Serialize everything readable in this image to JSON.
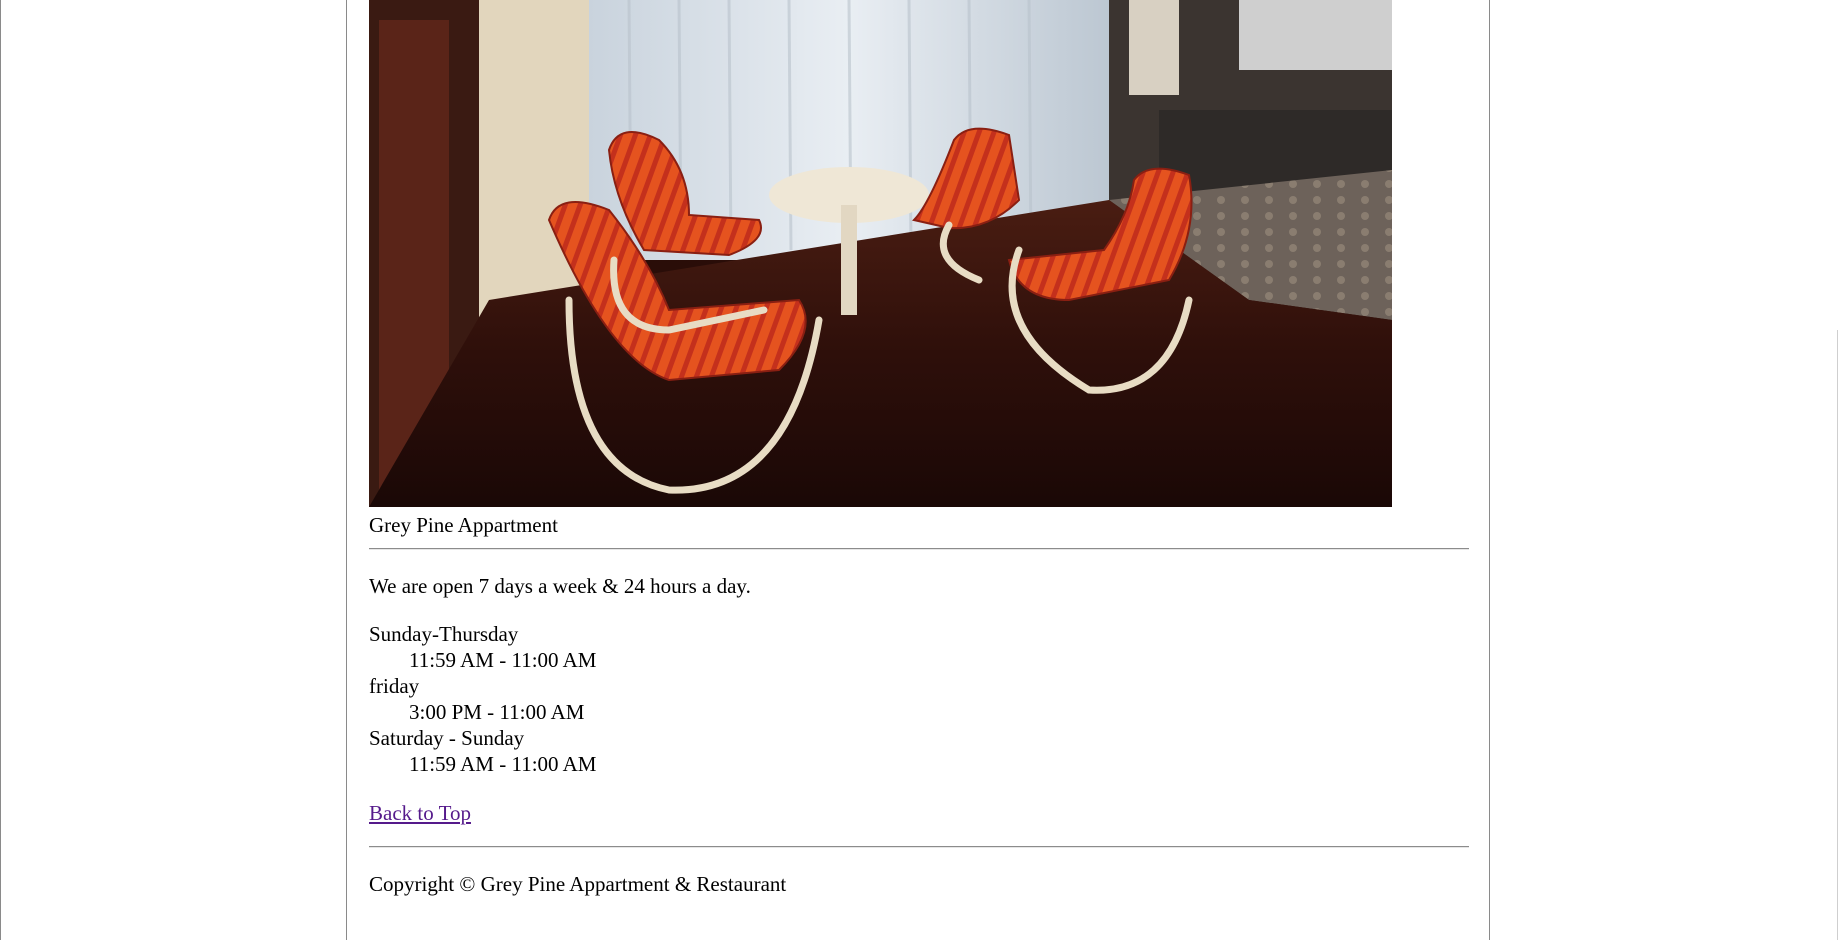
{
  "gallery": {
    "image_alt": "Lounge with four orange cushioned chairs around a round table",
    "caption": "Grey Pine Appartment"
  },
  "hours": {
    "intro": "We are open 7 days a week & 24 hours a day.",
    "schedule": [
      {
        "days": "Sunday-Thursday",
        "time": "11:59 AM - 11:00 AM"
      },
      {
        "days": "friday",
        "time": "3:00 PM - 11:00 AM"
      },
      {
        "days": "Saturday - Sunday",
        "time": "11:59 AM - 11:00 AM"
      }
    ]
  },
  "nav": {
    "back_to_top": "Back to Top"
  },
  "footer": {
    "copyright": "Copyright © Grey Pine Appartment & Restaurant"
  },
  "colors": {
    "link_visited": "#551a8b",
    "rule": "#8c8c8c",
    "border": "#8a8a8a"
  }
}
